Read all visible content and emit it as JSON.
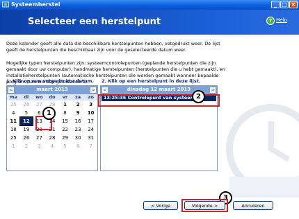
{
  "window": {
    "title": "Systeemherstel"
  },
  "header": {
    "title": "Selecteer een herstelpunt",
    "help": "Help"
  },
  "intro": {
    "p1": "Deze kalender geeft alle data die beschikbare herstelpunten hebben, vetgedrukt weer. De lijst geeft de herstelpunten die beschikbaar zijn voor de geselecteerde datum weer.",
    "p2": "Mogelijke typen herstelpunten zijn: systeemcontrolepunten (geplande herstelpunten die zijn gemaakt door uw computer), handmatige herstelpunten (herstelpunten die u hebt gemaakt), en installatieherstelpunten (automatische herstelpunten die worden gemaakt wanneer bepaalde programma's worden geïnstalleerd)."
  },
  "steps": {
    "step1": "1. Klik op een vetgedrukte datum.",
    "step2": "2. Klik op een herstelpunt in deze lijst."
  },
  "calendar": {
    "month": "maart 2013",
    "prev": "<",
    "next": ">",
    "weekdays": [
      "ma",
      "di",
      "wo",
      "do",
      "vr",
      "za",
      "zo"
    ],
    "days": [
      {
        "d": "25",
        "bold": false,
        "muted": true
      },
      {
        "d": "26",
        "bold": false,
        "muted": true
      },
      {
        "d": "27",
        "bold": false,
        "muted": true
      },
      {
        "d": "28",
        "bold": false,
        "muted": true
      },
      {
        "d": "1",
        "bold": true,
        "muted": false
      },
      {
        "d": "2",
        "bold": true,
        "muted": false
      },
      {
        "d": "3",
        "bold": true,
        "muted": false
      },
      {
        "d": "4",
        "bold": false,
        "muted": false
      },
      {
        "d": "5",
        "bold": false,
        "muted": false
      },
      {
        "d": "6",
        "bold": false,
        "muted": false
      },
      {
        "d": "7",
        "bold": true,
        "muted": false
      },
      {
        "d": "8",
        "bold": false,
        "muted": false
      },
      {
        "d": "9",
        "bold": true,
        "muted": false
      },
      {
        "d": "10",
        "bold": true,
        "muted": false
      },
      {
        "d": "11",
        "bold": true,
        "muted": false
      },
      {
        "d": "12",
        "bold": true,
        "muted": false,
        "selected": true
      },
      {
        "d": "13",
        "bold": false,
        "muted": false
      },
      {
        "d": "14",
        "bold": false,
        "muted": false
      },
      {
        "d": "15",
        "bold": false,
        "muted": false
      },
      {
        "d": "16",
        "bold": false,
        "muted": false
      },
      {
        "d": "17",
        "bold": false,
        "muted": false
      },
      {
        "d": "18",
        "bold": false,
        "muted": false
      },
      {
        "d": "19",
        "bold": false,
        "muted": false
      },
      {
        "d": "20",
        "bold": false,
        "muted": false
      },
      {
        "d": "21",
        "bold": false,
        "muted": false
      },
      {
        "d": "22",
        "bold": false,
        "muted": false
      },
      {
        "d": "23",
        "bold": false,
        "muted": false
      },
      {
        "d": "24",
        "bold": false,
        "muted": false
      },
      {
        "d": "25",
        "bold": false,
        "muted": false
      },
      {
        "d": "26",
        "bold": false,
        "muted": false
      },
      {
        "d": "27",
        "bold": false,
        "muted": false
      },
      {
        "d": "28",
        "bold": false,
        "muted": false
      },
      {
        "d": "29",
        "bold": false,
        "muted": false
      },
      {
        "d": "30",
        "bold": false,
        "muted": false
      },
      {
        "d": "31",
        "bold": false,
        "muted": false
      },
      {
        "d": "1",
        "bold": false,
        "muted": true
      },
      {
        "d": "2",
        "bold": false,
        "muted": true
      },
      {
        "d": "3",
        "bold": false,
        "muted": true
      },
      {
        "d": "4",
        "bold": false,
        "muted": true
      },
      {
        "d": "5",
        "bold": false,
        "muted": true
      },
      {
        "d": "6",
        "bold": false,
        "muted": true
      },
      {
        "d": "7",
        "bold": false,
        "muted": true
      }
    ]
  },
  "list": {
    "date_title": "dinsdag 12 maart 2013",
    "items": [
      "13:25:35  Controlepunt van systeem"
    ]
  },
  "callouts": [
    "1",
    "2",
    "3"
  ],
  "buttons": {
    "back": "< Vorige",
    "next": "Volgende >",
    "cancel": "Annuleren"
  },
  "colors": {
    "header": "#1c5fd6",
    "highlight": "#d0202a",
    "selection": "#0a246a"
  }
}
